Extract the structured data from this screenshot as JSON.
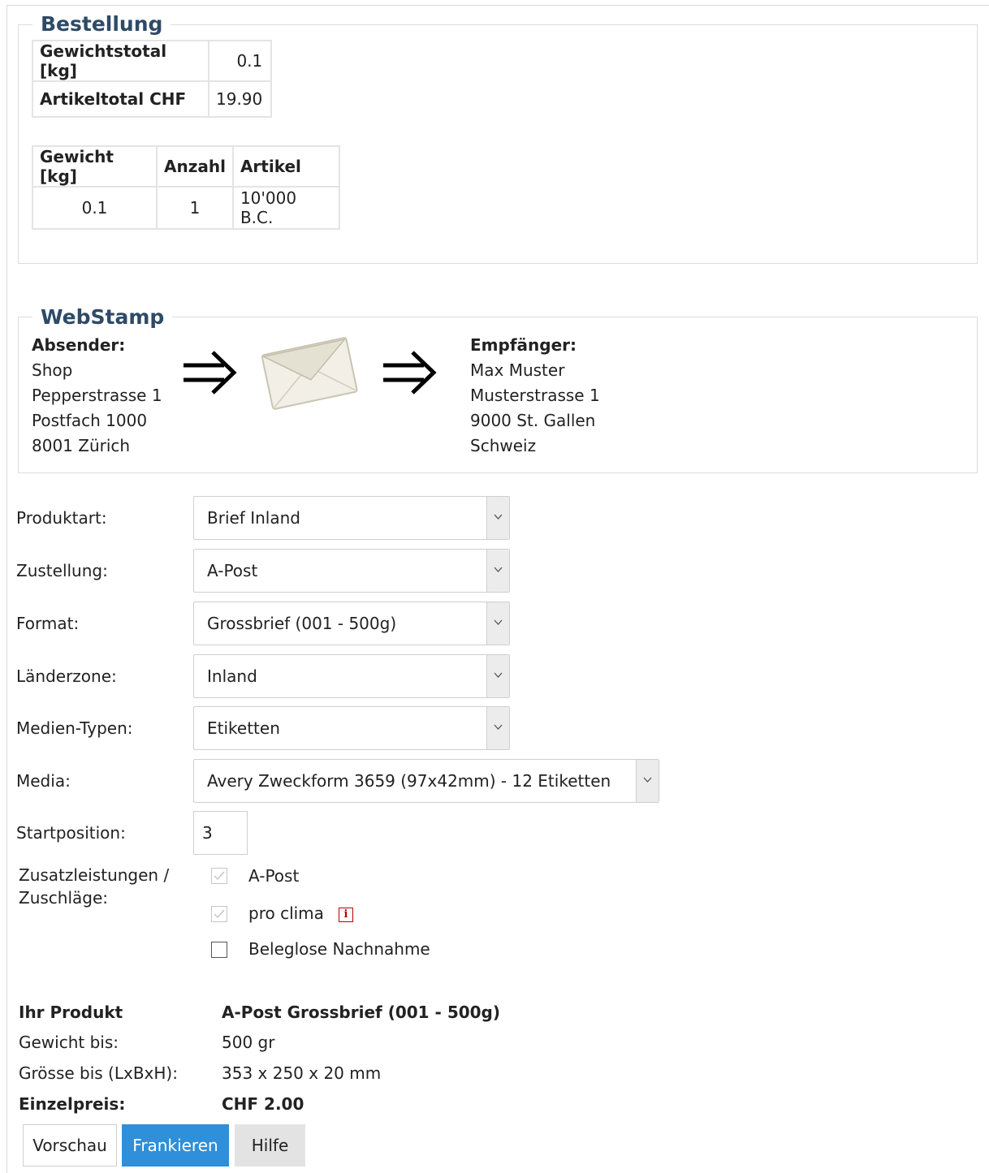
{
  "order": {
    "legend": "Bestellung",
    "totals": [
      {
        "label": "Gewichtstotal [kg]",
        "value": "0.1"
      },
      {
        "label": "Artikeltotal CHF",
        "value": "19.90"
      }
    ],
    "items_headers": [
      "Gewicht [kg]",
      "Anzahl",
      "Artikel"
    ],
    "items": [
      {
        "weight": "0.1",
        "qty": "1",
        "article": "10'000 B.C."
      }
    ]
  },
  "webstamp": {
    "legend": "WebStamp",
    "sender": {
      "heading": "Absender:",
      "lines": [
        "Shop",
        "Pepperstrasse 1",
        "Postfach 1000",
        "8001 Zürich"
      ]
    },
    "recipient": {
      "heading": "Empfänger:",
      "lines": [
        "Max Muster",
        "Musterstrasse 1",
        "9000 St. Gallen",
        "Schweiz"
      ]
    },
    "icons": [
      "arrow-right-icon",
      "envelope-icon",
      "arrow-right-icon"
    ]
  },
  "form": {
    "product_type": {
      "label": "Produktart:",
      "value": "Brief Inland"
    },
    "delivery": {
      "label": "Zustellung:",
      "value": "A-Post"
    },
    "format": {
      "label": "Format:",
      "value": "Grossbrief (001 - 500g)"
    },
    "zone": {
      "label": "Länderzone:",
      "value": "Inland"
    },
    "media_type": {
      "label": "Medien-Typen:",
      "value": "Etiketten"
    },
    "media": {
      "label": "Media:",
      "value": "Avery Zweckform 3659 (97x42mm) - 12 Etiketten"
    },
    "start_position": {
      "label": "Startposition:",
      "value": "3"
    },
    "extras": {
      "label_line1": "Zusatzleistungen /",
      "label_line2": "Zuschläge:",
      "options": [
        {
          "label": "A-Post",
          "checked": true,
          "disabled": true
        },
        {
          "label": "pro clima",
          "checked": true,
          "disabled": true
        },
        {
          "label": "Beleglose Nachnahme",
          "checked": false,
          "disabled": false
        }
      ]
    }
  },
  "summary": {
    "product_label": "Ihr Produkt",
    "product_value": "A-Post Grossbrief (001 - 500g)",
    "weight_label": "Gewicht bis:",
    "weight_value": "500 gr",
    "size_label": "Grösse bis (LxBxH):",
    "size_value": "353 x 250 x 20 mm",
    "price_label": "Einzelpreis:",
    "price_value": "CHF 2.00"
  },
  "buttons": {
    "preview": "Vorschau",
    "frank": "Frankieren",
    "help": "Hilfe"
  },
  "colors": {
    "legend": "#2e4a66",
    "primary_button": "#2f8fd8",
    "info_icon": "#bb0000"
  }
}
